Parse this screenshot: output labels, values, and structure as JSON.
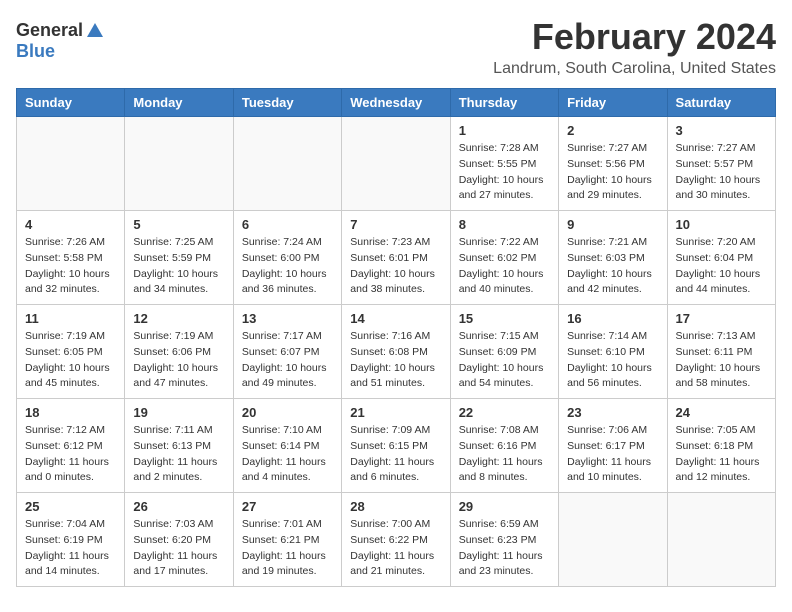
{
  "header": {
    "logo_general": "General",
    "logo_blue": "Blue",
    "month": "February 2024",
    "location": "Landrum, South Carolina, United States"
  },
  "weekdays": [
    "Sunday",
    "Monday",
    "Tuesday",
    "Wednesday",
    "Thursday",
    "Friday",
    "Saturday"
  ],
  "weeks": [
    [
      {
        "day": "",
        "info": ""
      },
      {
        "day": "",
        "info": ""
      },
      {
        "day": "",
        "info": ""
      },
      {
        "day": "",
        "info": ""
      },
      {
        "day": "1",
        "info": "Sunrise: 7:28 AM\nSunset: 5:55 PM\nDaylight: 10 hours\nand 27 minutes."
      },
      {
        "day": "2",
        "info": "Sunrise: 7:27 AM\nSunset: 5:56 PM\nDaylight: 10 hours\nand 29 minutes."
      },
      {
        "day": "3",
        "info": "Sunrise: 7:27 AM\nSunset: 5:57 PM\nDaylight: 10 hours\nand 30 minutes."
      }
    ],
    [
      {
        "day": "4",
        "info": "Sunrise: 7:26 AM\nSunset: 5:58 PM\nDaylight: 10 hours\nand 32 minutes."
      },
      {
        "day": "5",
        "info": "Sunrise: 7:25 AM\nSunset: 5:59 PM\nDaylight: 10 hours\nand 34 minutes."
      },
      {
        "day": "6",
        "info": "Sunrise: 7:24 AM\nSunset: 6:00 PM\nDaylight: 10 hours\nand 36 minutes."
      },
      {
        "day": "7",
        "info": "Sunrise: 7:23 AM\nSunset: 6:01 PM\nDaylight: 10 hours\nand 38 minutes."
      },
      {
        "day": "8",
        "info": "Sunrise: 7:22 AM\nSunset: 6:02 PM\nDaylight: 10 hours\nand 40 minutes."
      },
      {
        "day": "9",
        "info": "Sunrise: 7:21 AM\nSunset: 6:03 PM\nDaylight: 10 hours\nand 42 minutes."
      },
      {
        "day": "10",
        "info": "Sunrise: 7:20 AM\nSunset: 6:04 PM\nDaylight: 10 hours\nand 44 minutes."
      }
    ],
    [
      {
        "day": "11",
        "info": "Sunrise: 7:19 AM\nSunset: 6:05 PM\nDaylight: 10 hours\nand 45 minutes."
      },
      {
        "day": "12",
        "info": "Sunrise: 7:19 AM\nSunset: 6:06 PM\nDaylight: 10 hours\nand 47 minutes."
      },
      {
        "day": "13",
        "info": "Sunrise: 7:17 AM\nSunset: 6:07 PM\nDaylight: 10 hours\nand 49 minutes."
      },
      {
        "day": "14",
        "info": "Sunrise: 7:16 AM\nSunset: 6:08 PM\nDaylight: 10 hours\nand 51 minutes."
      },
      {
        "day": "15",
        "info": "Sunrise: 7:15 AM\nSunset: 6:09 PM\nDaylight: 10 hours\nand 54 minutes."
      },
      {
        "day": "16",
        "info": "Sunrise: 7:14 AM\nSunset: 6:10 PM\nDaylight: 10 hours\nand 56 minutes."
      },
      {
        "day": "17",
        "info": "Sunrise: 7:13 AM\nSunset: 6:11 PM\nDaylight: 10 hours\nand 58 minutes."
      }
    ],
    [
      {
        "day": "18",
        "info": "Sunrise: 7:12 AM\nSunset: 6:12 PM\nDaylight: 11 hours\nand 0 minutes."
      },
      {
        "day": "19",
        "info": "Sunrise: 7:11 AM\nSunset: 6:13 PM\nDaylight: 11 hours\nand 2 minutes."
      },
      {
        "day": "20",
        "info": "Sunrise: 7:10 AM\nSunset: 6:14 PM\nDaylight: 11 hours\nand 4 minutes."
      },
      {
        "day": "21",
        "info": "Sunrise: 7:09 AM\nSunset: 6:15 PM\nDaylight: 11 hours\nand 6 minutes."
      },
      {
        "day": "22",
        "info": "Sunrise: 7:08 AM\nSunset: 6:16 PM\nDaylight: 11 hours\nand 8 minutes."
      },
      {
        "day": "23",
        "info": "Sunrise: 7:06 AM\nSunset: 6:17 PM\nDaylight: 11 hours\nand 10 minutes."
      },
      {
        "day": "24",
        "info": "Sunrise: 7:05 AM\nSunset: 6:18 PM\nDaylight: 11 hours\nand 12 minutes."
      }
    ],
    [
      {
        "day": "25",
        "info": "Sunrise: 7:04 AM\nSunset: 6:19 PM\nDaylight: 11 hours\nand 14 minutes."
      },
      {
        "day": "26",
        "info": "Sunrise: 7:03 AM\nSunset: 6:20 PM\nDaylight: 11 hours\nand 17 minutes."
      },
      {
        "day": "27",
        "info": "Sunrise: 7:01 AM\nSunset: 6:21 PM\nDaylight: 11 hours\nand 19 minutes."
      },
      {
        "day": "28",
        "info": "Sunrise: 7:00 AM\nSunset: 6:22 PM\nDaylight: 11 hours\nand 21 minutes."
      },
      {
        "day": "29",
        "info": "Sunrise: 6:59 AM\nSunset: 6:23 PM\nDaylight: 11 hours\nand 23 minutes."
      },
      {
        "day": "",
        "info": ""
      },
      {
        "day": "",
        "info": ""
      }
    ]
  ]
}
